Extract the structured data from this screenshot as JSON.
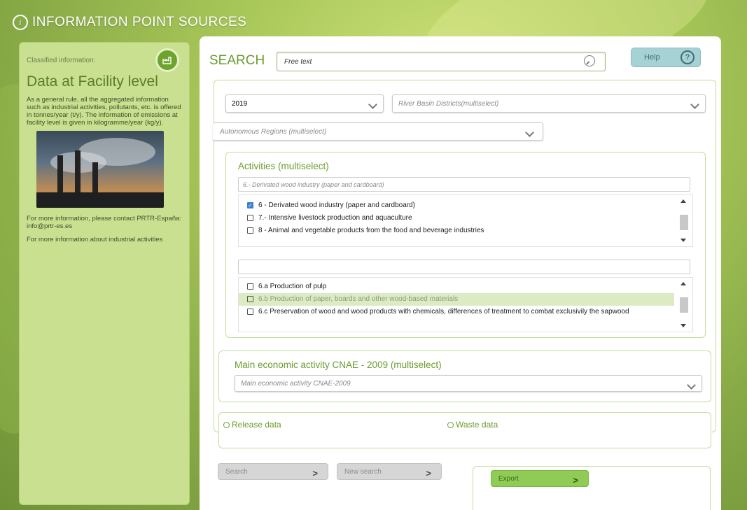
{
  "header": {
    "title": "INFORMATION POINT SOURCES"
  },
  "sidebar": {
    "classified_label": "Classified information:",
    "title": "Data at Facility level",
    "paragraph1": "As a general rule, all the aggregated information such as industrial activities, pollutants, etc. is offered in tonnes/year (t/y). The information of emissions at facility level is given in kilogramme/year (kg/y).",
    "paragraph2": "For more information, please contact PRTR-España: info@prtr-es.es",
    "paragraph3": "For more information about industrial activities"
  },
  "search": {
    "label": "SEARCH",
    "value": "Free text",
    "help_label": "Help"
  },
  "filters": {
    "year": "2019",
    "river_basin_placeholder": "River Basin Districts(multiselect)",
    "regions_placeholder": "Autonomous Regions (multiselect)"
  },
  "activities": {
    "title": "Activities (multiselect)",
    "filter_value": "6.- Derivated wood industry (paper and cardboard)",
    "items": [
      {
        "label": "6 - Derivated wood industry (paper and cardboard)",
        "checked": true
      },
      {
        "label": "7.- Intensive livestock production and aquaculture",
        "checked": false
      },
      {
        "label": "8 - Animal and vegetable products from the food and beverage industries",
        "checked": false
      }
    ],
    "sub_filter_value": "",
    "sub_items": [
      {
        "label": "6.a Production of pulp",
        "checked": false,
        "selected": false
      },
      {
        "label": "6.b Production of paper, boards and other wood-based materials",
        "checked": false,
        "selected": true
      },
      {
        "label": "6.c Preservation of wood and wood products with chemicals, differences of treatment to combat exclusivily the sapwood",
        "checked": false,
        "selected": false
      }
    ]
  },
  "cnae": {
    "title": "Main economic activity CNAE - 2009 (multiselect)",
    "placeholder": "Main economic activity CNAE-2009"
  },
  "data_type": {
    "release_label": "Release data",
    "waste_label": "Waste data"
  },
  "buttons": {
    "search": "Search",
    "new_search": "New search",
    "export": "Export"
  }
}
